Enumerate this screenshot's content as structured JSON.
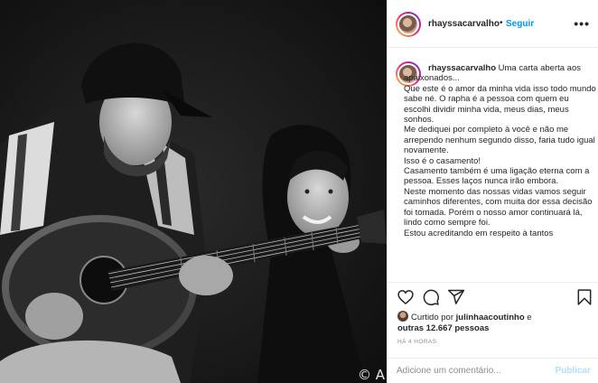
{
  "photo": {
    "credit": "© A",
    "description_icon": "photo-image"
  },
  "header": {
    "username": "rhayssacarvalho",
    "dot": "•",
    "follow_label": "Seguir",
    "more_icon": "more-horizontal-icon"
  },
  "caption": {
    "username": "rhayssacarvalho",
    "lines": [
      "Uma carta aberta aos apaixonados...",
      "Que este é o amor da minha vida isso todo mundo sabe né. O rapha é a pessoa com quem eu escolhi dividir minha vida, meus dias, meus sonhos.",
      "Me dediquei por completo à você e não me arrependo nenhum segundo disso, faria tudo igual novamente.",
      "Isso é o casamento!",
      "Casamento também é uma ligação eterna com a pessoa. Esses laços nunca irão embora.",
      "Neste momento das nossas vidas vamos seguir caminhos diferentes, com muita dor essa decisão foi tomada. Porém o nosso amor continuará lá, lindo como sempre foi.",
      "Estou acreditando em respeito à tantos"
    ]
  },
  "actions": {
    "icons": [
      "heart-icon",
      "comment-icon",
      "share-icon",
      "bookmark-icon"
    ],
    "liked_prefix": "Curtido por",
    "liked_user": "julinhaacoutinho",
    "liked_and": "e",
    "liked_others": "outras 12.667 pessoas",
    "time": "HÁ 4 HORAS"
  },
  "comment": {
    "placeholder": "Adicione um comentário...",
    "publish_label": "Publicar"
  }
}
